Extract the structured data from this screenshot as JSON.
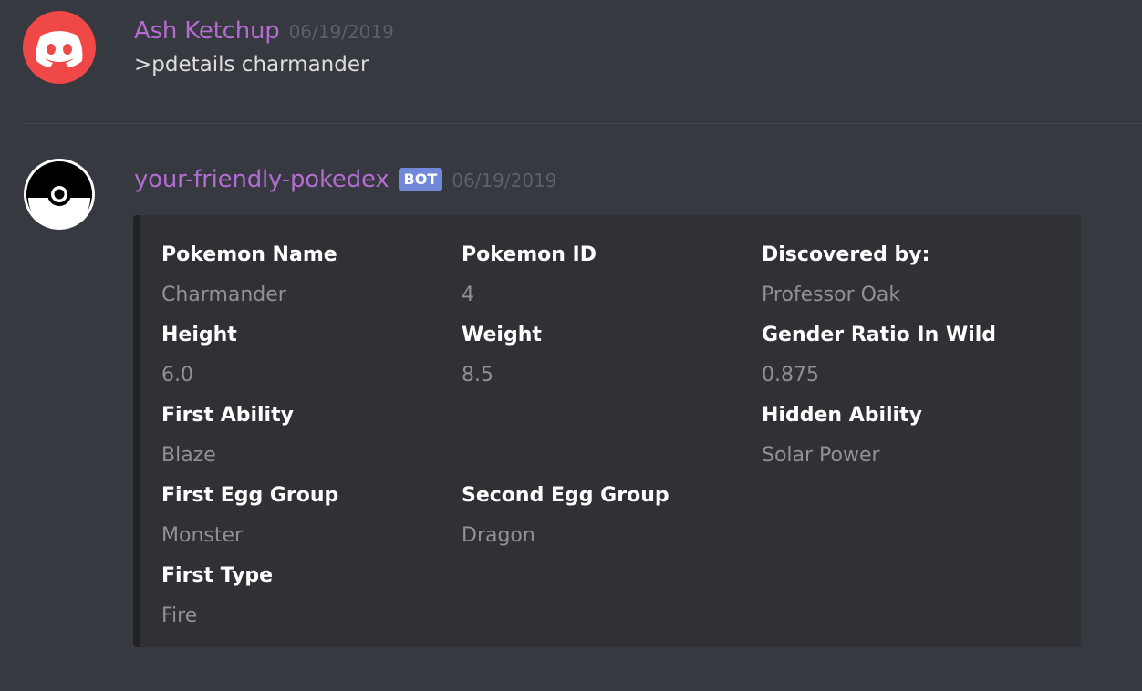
{
  "messages": {
    "user": {
      "username": "Ash Ketchup",
      "timestamp": "06/19/2019",
      "content": ">pdetails charmander",
      "avatar_icon": "discord-logo-icon",
      "avatar_color": "#f04747"
    },
    "bot": {
      "username": "your-friendly-pokedex",
      "bot_tag": "BOT",
      "timestamp": "06/19/2019",
      "avatar_icon": "pokeball-icon",
      "embed": {
        "fields": [
          {
            "name": "Pokemon Name",
            "value": "Charmander"
          },
          {
            "name": "Pokemon ID",
            "value": "4"
          },
          {
            "name": "Discovered by:",
            "value": "Professor Oak"
          },
          {
            "name": "Height",
            "value": "6.0"
          },
          {
            "name": "Weight",
            "value": "8.5"
          },
          {
            "name": "Gender Ratio In Wild",
            "value": "0.875"
          },
          {
            "name": "First Ability",
            "value": "Blaze"
          },
          {
            "name": "Hidden Ability",
            "value": "Solar Power"
          },
          {
            "name": "First Egg Group",
            "value": "Monster"
          },
          {
            "name": "Second Egg Group",
            "value": "Dragon"
          },
          {
            "name": "First Type",
            "value": "Fire"
          }
        ]
      }
    }
  },
  "colors": {
    "background": "#36393f",
    "username": "#b36cd0",
    "timestamp": "#5d6066",
    "bot_tag": "#7289da",
    "embed_background": "#2f3136",
    "field_name": "#ffffff",
    "field_value": "#8e9297"
  }
}
